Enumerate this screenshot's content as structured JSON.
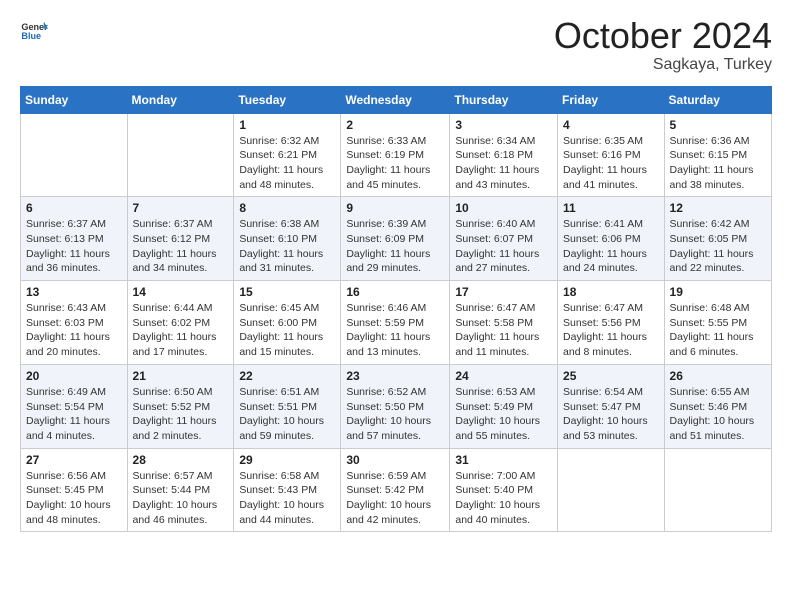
{
  "logo": {
    "line1": "General",
    "line2": "Blue"
  },
  "header": {
    "month": "October 2024",
    "location": "Sagkaya, Turkey"
  },
  "weekdays": [
    "Sunday",
    "Monday",
    "Tuesday",
    "Wednesday",
    "Thursday",
    "Friday",
    "Saturday"
  ],
  "rows": [
    [
      {
        "day": "",
        "sunrise": "",
        "sunset": "",
        "daylight": ""
      },
      {
        "day": "",
        "sunrise": "",
        "sunset": "",
        "daylight": ""
      },
      {
        "day": "1",
        "sunrise": "Sunrise: 6:32 AM",
        "sunset": "Sunset: 6:21 PM",
        "daylight": "Daylight: 11 hours and 48 minutes."
      },
      {
        "day": "2",
        "sunrise": "Sunrise: 6:33 AM",
        "sunset": "Sunset: 6:19 PM",
        "daylight": "Daylight: 11 hours and 45 minutes."
      },
      {
        "day": "3",
        "sunrise": "Sunrise: 6:34 AM",
        "sunset": "Sunset: 6:18 PM",
        "daylight": "Daylight: 11 hours and 43 minutes."
      },
      {
        "day": "4",
        "sunrise": "Sunrise: 6:35 AM",
        "sunset": "Sunset: 6:16 PM",
        "daylight": "Daylight: 11 hours and 41 minutes."
      },
      {
        "day": "5",
        "sunrise": "Sunrise: 6:36 AM",
        "sunset": "Sunset: 6:15 PM",
        "daylight": "Daylight: 11 hours and 38 minutes."
      }
    ],
    [
      {
        "day": "6",
        "sunrise": "Sunrise: 6:37 AM",
        "sunset": "Sunset: 6:13 PM",
        "daylight": "Daylight: 11 hours and 36 minutes."
      },
      {
        "day": "7",
        "sunrise": "Sunrise: 6:37 AM",
        "sunset": "Sunset: 6:12 PM",
        "daylight": "Daylight: 11 hours and 34 minutes."
      },
      {
        "day": "8",
        "sunrise": "Sunrise: 6:38 AM",
        "sunset": "Sunset: 6:10 PM",
        "daylight": "Daylight: 11 hours and 31 minutes."
      },
      {
        "day": "9",
        "sunrise": "Sunrise: 6:39 AM",
        "sunset": "Sunset: 6:09 PM",
        "daylight": "Daylight: 11 hours and 29 minutes."
      },
      {
        "day": "10",
        "sunrise": "Sunrise: 6:40 AM",
        "sunset": "Sunset: 6:07 PM",
        "daylight": "Daylight: 11 hours and 27 minutes."
      },
      {
        "day": "11",
        "sunrise": "Sunrise: 6:41 AM",
        "sunset": "Sunset: 6:06 PM",
        "daylight": "Daylight: 11 hours and 24 minutes."
      },
      {
        "day": "12",
        "sunrise": "Sunrise: 6:42 AM",
        "sunset": "Sunset: 6:05 PM",
        "daylight": "Daylight: 11 hours and 22 minutes."
      }
    ],
    [
      {
        "day": "13",
        "sunrise": "Sunrise: 6:43 AM",
        "sunset": "Sunset: 6:03 PM",
        "daylight": "Daylight: 11 hours and 20 minutes."
      },
      {
        "day": "14",
        "sunrise": "Sunrise: 6:44 AM",
        "sunset": "Sunset: 6:02 PM",
        "daylight": "Daylight: 11 hours and 17 minutes."
      },
      {
        "day": "15",
        "sunrise": "Sunrise: 6:45 AM",
        "sunset": "Sunset: 6:00 PM",
        "daylight": "Daylight: 11 hours and 15 minutes."
      },
      {
        "day": "16",
        "sunrise": "Sunrise: 6:46 AM",
        "sunset": "Sunset: 5:59 PM",
        "daylight": "Daylight: 11 hours and 13 minutes."
      },
      {
        "day": "17",
        "sunrise": "Sunrise: 6:47 AM",
        "sunset": "Sunset: 5:58 PM",
        "daylight": "Daylight: 11 hours and 11 minutes."
      },
      {
        "day": "18",
        "sunrise": "Sunrise: 6:47 AM",
        "sunset": "Sunset: 5:56 PM",
        "daylight": "Daylight: 11 hours and 8 minutes."
      },
      {
        "day": "19",
        "sunrise": "Sunrise: 6:48 AM",
        "sunset": "Sunset: 5:55 PM",
        "daylight": "Daylight: 11 hours and 6 minutes."
      }
    ],
    [
      {
        "day": "20",
        "sunrise": "Sunrise: 6:49 AM",
        "sunset": "Sunset: 5:54 PM",
        "daylight": "Daylight: 11 hours and 4 minutes."
      },
      {
        "day": "21",
        "sunrise": "Sunrise: 6:50 AM",
        "sunset": "Sunset: 5:52 PM",
        "daylight": "Daylight: 11 hours and 2 minutes."
      },
      {
        "day": "22",
        "sunrise": "Sunrise: 6:51 AM",
        "sunset": "Sunset: 5:51 PM",
        "daylight": "Daylight: 10 hours and 59 minutes."
      },
      {
        "day": "23",
        "sunrise": "Sunrise: 6:52 AM",
        "sunset": "Sunset: 5:50 PM",
        "daylight": "Daylight: 10 hours and 57 minutes."
      },
      {
        "day": "24",
        "sunrise": "Sunrise: 6:53 AM",
        "sunset": "Sunset: 5:49 PM",
        "daylight": "Daylight: 10 hours and 55 minutes."
      },
      {
        "day": "25",
        "sunrise": "Sunrise: 6:54 AM",
        "sunset": "Sunset: 5:47 PM",
        "daylight": "Daylight: 10 hours and 53 minutes."
      },
      {
        "day": "26",
        "sunrise": "Sunrise: 6:55 AM",
        "sunset": "Sunset: 5:46 PM",
        "daylight": "Daylight: 10 hours and 51 minutes."
      }
    ],
    [
      {
        "day": "27",
        "sunrise": "Sunrise: 6:56 AM",
        "sunset": "Sunset: 5:45 PM",
        "daylight": "Daylight: 10 hours and 48 minutes."
      },
      {
        "day": "28",
        "sunrise": "Sunrise: 6:57 AM",
        "sunset": "Sunset: 5:44 PM",
        "daylight": "Daylight: 10 hours and 46 minutes."
      },
      {
        "day": "29",
        "sunrise": "Sunrise: 6:58 AM",
        "sunset": "Sunset: 5:43 PM",
        "daylight": "Daylight: 10 hours and 44 minutes."
      },
      {
        "day": "30",
        "sunrise": "Sunrise: 6:59 AM",
        "sunset": "Sunset: 5:42 PM",
        "daylight": "Daylight: 10 hours and 42 minutes."
      },
      {
        "day": "31",
        "sunrise": "Sunrise: 7:00 AM",
        "sunset": "Sunset: 5:40 PM",
        "daylight": "Daylight: 10 hours and 40 minutes."
      },
      {
        "day": "",
        "sunrise": "",
        "sunset": "",
        "daylight": ""
      },
      {
        "day": "",
        "sunrise": "",
        "sunset": "",
        "daylight": ""
      }
    ]
  ]
}
